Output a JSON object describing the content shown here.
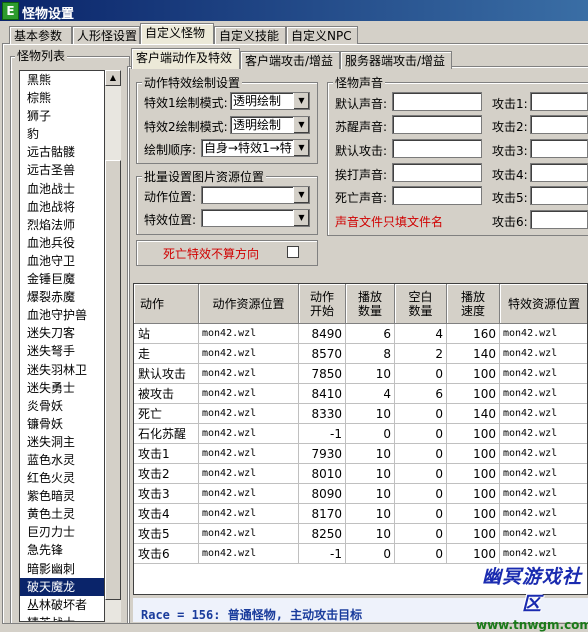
{
  "window": {
    "title": "怪物设置",
    "app_icon": "E"
  },
  "tabs_top": [
    "基本参数",
    "人形怪设置",
    "自定义怪物",
    "自定义技能",
    "自定义NPC"
  ],
  "tabs_sub": [
    "客户端动作及特效",
    "客户端攻击/增益",
    "服务器端攻击/增益"
  ],
  "monster_list": {
    "title": "怪物列表",
    "items": [
      "黑熊",
      "棕熊",
      "狮子",
      "豹",
      "远古骷髅",
      "远古圣兽",
      "血池战士",
      "血池战将",
      "烈焰法师",
      "血池兵役",
      "血池守卫",
      "金锤巨魔",
      "爆裂赤魔",
      "血池守护兽",
      "迷失刀客",
      "迷失弩手",
      "迷失羽林卫",
      "迷失勇士",
      "炎骨妖",
      "镰骨妖",
      "迷失洞主",
      "蓝色水灵",
      "红色火灵",
      "紫色暗灵",
      "黄色土灵",
      "巨刃力士",
      "急先锋",
      "暗影幽刺",
      "破天魔龙",
      "丛林破坏者",
      "精英战士"
    ],
    "selected_index": 28
  },
  "action_effects": {
    "title": "动作特效绘制设置",
    "effect1_label": "特效1绘制模式:",
    "effect1_value": "透明绘制",
    "effect2_label": "特效2绘制模式:",
    "effect2_value": "透明绘制",
    "order_label": "绘制顺序:",
    "order_value": "自身→特效1→特"
  },
  "batch": {
    "title": "批量设置图片资源位置",
    "action_label": "动作位置:",
    "action_value": "",
    "effect_label": "特效位置:",
    "effect_value": ""
  },
  "death_effect": {
    "label": "死亡特效不算方向",
    "checked": false
  },
  "sound": {
    "title": "怪物声音",
    "left_labels": [
      "默认声音:",
      "苏醒声音:",
      "默认攻击:",
      "挨打声音:",
      "死亡声音:"
    ],
    "right_labels": [
      "攻击1:",
      "攻击2:",
      "攻击3:",
      "攻击4:",
      "攻击5:",
      "攻击6:"
    ],
    "note": "声音文件只填文件名"
  },
  "grid": {
    "headers": [
      "动作",
      "动作资源位置",
      "动作\n开始",
      "播放\n数量",
      "空白\n数量",
      "播放\n速度",
      "特效资源位置"
    ],
    "rows": [
      [
        "站",
        "mon42.wzl",
        "8490",
        "6",
        "4",
        "160",
        "mon42.wzl"
      ],
      [
        "走",
        "mon42.wzl",
        "8570",
        "8",
        "2",
        "140",
        "mon42.wzl"
      ],
      [
        "默认攻击",
        "mon42.wzl",
        "7850",
        "10",
        "0",
        "100",
        "mon42.wzl"
      ],
      [
        "被攻击",
        "mon42.wzl",
        "8410",
        "4",
        "6",
        "100",
        "mon42.wzl"
      ],
      [
        "死亡",
        "mon42.wzl",
        "8330",
        "10",
        "0",
        "140",
        "mon42.wzl"
      ],
      [
        "石化苏醒",
        "mon42.wzl",
        "-1",
        "0",
        "0",
        "100",
        "mon42.wzl"
      ],
      [
        "攻击1",
        "mon42.wzl",
        "7930",
        "10",
        "0",
        "100",
        "mon42.wzl"
      ],
      [
        "攻击2",
        "mon42.wzl",
        "8010",
        "10",
        "0",
        "100",
        "mon42.wzl"
      ],
      [
        "攻击3",
        "mon42.wzl",
        "8090",
        "10",
        "0",
        "100",
        "mon42.wzl"
      ],
      [
        "攻击4",
        "mon42.wzl",
        "8170",
        "10",
        "0",
        "100",
        "mon42.wzl"
      ],
      [
        "攻击5",
        "mon42.wzl",
        "8250",
        "10",
        "0",
        "100",
        "mon42.wzl"
      ],
      [
        "攻击6",
        "mon42.wzl",
        "-1",
        "0",
        "0",
        "100",
        "mon42.wzl"
      ]
    ]
  },
  "status_text": "Race = 156: 普通怪物, 主动攻击目标",
  "watermark": {
    "title": "幽冥游戏社区",
    "url": "www.tnwgm.com"
  }
}
